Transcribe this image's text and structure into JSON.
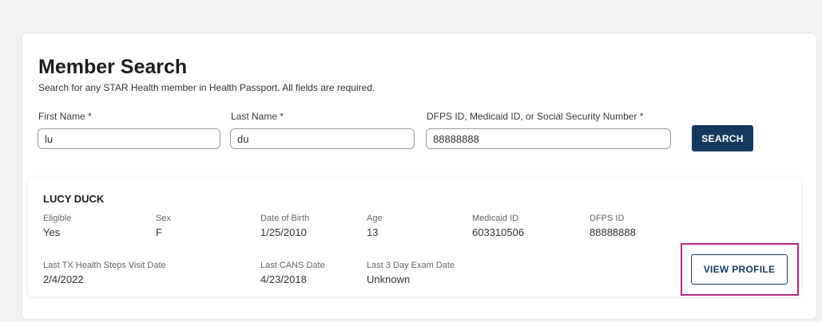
{
  "title": "Member Search",
  "subtitle": "Search for any STAR Health member in Health Passport. All fields are required.",
  "fields": {
    "first_name": {
      "label": "First Name",
      "required_mark": "*",
      "value": "lu"
    },
    "last_name": {
      "label": "Last Name",
      "required_mark": "*",
      "value": "du"
    },
    "id_number": {
      "label": "DFPS ID, Medicaid ID, or Social Security Number",
      "required_mark": "*",
      "value": "88888888"
    }
  },
  "search_button": "SEARCH",
  "result": {
    "name": "LUCY DUCK",
    "eligible": {
      "label": "Eligible",
      "value": "Yes"
    },
    "sex": {
      "label": "Sex",
      "value": "F"
    },
    "dob": {
      "label": "Date of Birth",
      "value": "1/25/2010"
    },
    "age": {
      "label": "Age",
      "value": "13"
    },
    "medicaid_id": {
      "label": "Medicaid ID",
      "value": "603310506"
    },
    "dfps_id": {
      "label": "DFPS ID",
      "value": "88888888"
    },
    "last_tx": {
      "label": "Last TX Health Steps Visit Date",
      "value": "2/4/2022"
    },
    "last_cans": {
      "label": "Last CANS Date",
      "value": "4/23/2018"
    },
    "last_3day": {
      "label": "Last 3 Day Exam Date",
      "value": "Unknown"
    },
    "view_profile_button": "VIEW PROFILE"
  },
  "colors": {
    "primary": "#163a5f",
    "highlight": "#b42a84",
    "page_background": "#f1f1f1"
  }
}
